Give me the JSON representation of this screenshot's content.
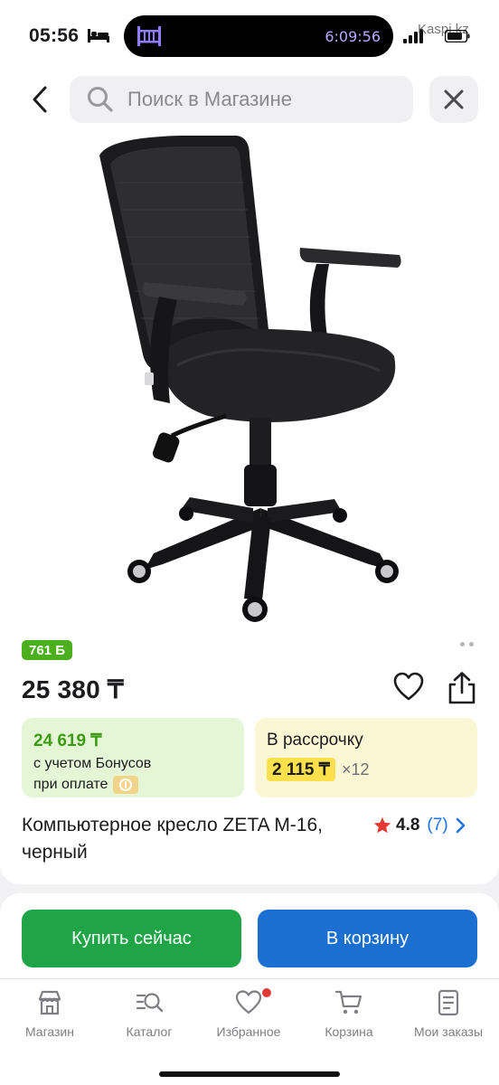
{
  "status_bar": {
    "time": "05:56",
    "timer": "6:09:56",
    "watermark": "Kaspi.kz"
  },
  "search": {
    "placeholder": "Поиск в Магазине"
  },
  "product": {
    "bonus_badge": "761 Б",
    "price": "25 380 ₸",
    "bonus_price": "24 619 ₸",
    "bonus_line1": "с учетом Бонусов",
    "bonus_line2": "при оплате",
    "installment_title": "В рассрочку",
    "installment_amount": "2 115 ₸",
    "installment_multiplier": "×12",
    "title": "Компьютерное кресло ZETA M-16, черный",
    "rating": "4.8",
    "reviews": "(7)",
    "colors": {
      "bonus_green": "#3c9b12",
      "star": "#e53935",
      "link_blue": "#1a73e8"
    }
  },
  "actions": {
    "buy_now": "Купить сейчас",
    "add_to_cart": "В корзину",
    "buy_color": "#1fa546",
    "cart_color": "#1a6fd1"
  },
  "tabs": [
    {
      "label": "Магазин",
      "icon": "store-icon"
    },
    {
      "label": "Каталог",
      "icon": "catalog-icon"
    },
    {
      "label": "Избранное",
      "icon": "heart-icon"
    },
    {
      "label": "Корзина",
      "icon": "cart-icon"
    },
    {
      "label": "Мои заказы",
      "icon": "orders-icon"
    }
  ]
}
